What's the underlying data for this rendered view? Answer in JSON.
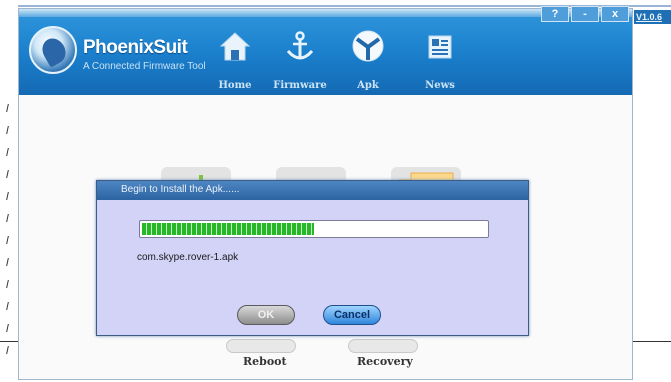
{
  "window": {
    "app_title": "PhoenixSuit",
    "app_subtitle": "A Connected Firmware Tool",
    "version": "V1.0.6",
    "controls": {
      "help": "?",
      "minimize": "-",
      "close": "x"
    }
  },
  "nav": [
    {
      "label": "Home",
      "icon": "home-icon"
    },
    {
      "label": "Firmware",
      "icon": "anchor-icon"
    },
    {
      "label": "Apk",
      "icon": "apk-icon"
    },
    {
      "label": "News",
      "icon": "news-icon"
    }
  ],
  "background": {
    "reboot_label": "Reboot",
    "recovery_label": "Recovery"
  },
  "dialog": {
    "title": "Begin to Install the Apk......",
    "progress": 0.5,
    "package_name": "com.skype.rover-1.apk",
    "ok_label": "OK",
    "cancel_label": "Cancel"
  },
  "colors": {
    "header": "#1a7ecb",
    "dialog_bg": "#d3d2f7",
    "progress_green": "#27b827"
  }
}
